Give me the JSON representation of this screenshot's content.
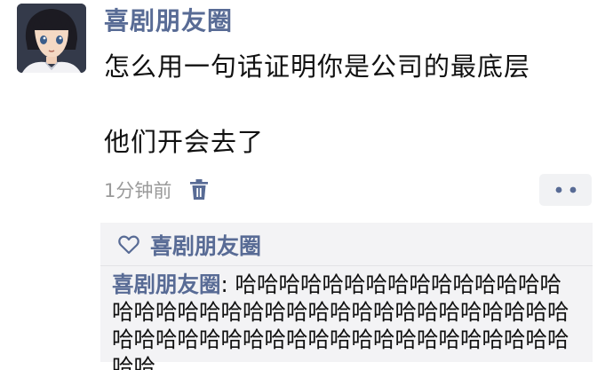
{
  "post": {
    "author": "喜剧朋友圈",
    "text_line1": "怎么用一句话证明你是公司的最底层",
    "text_line2": "他们开会去了",
    "timestamp": "1分钟前"
  },
  "icons": {
    "avatar": "anime-boy-avatar",
    "delete": "trash-icon",
    "more": "more-dots-icon",
    "like": "heart-icon"
  },
  "interactions": {
    "likes": "喜剧朋友圈",
    "comments": [
      {
        "author": "喜剧朋友圈",
        "separator": ": ",
        "text": "哈哈哈哈哈哈哈哈哈哈哈哈哈哈哈哈哈哈哈哈哈哈哈哈哈哈哈哈哈哈哈哈哈哈哈哈哈哈哈哈哈哈哈哈哈哈哈哈哈哈哈哈哈哈哈哈哈哈哈"
      }
    ]
  },
  "colors": {
    "name_blue": "#586b95",
    "text": "#111111",
    "meta_gray": "#9a9a9a",
    "comment_bg": "#f3f3f5",
    "more_bg": "#f1f2f4"
  }
}
